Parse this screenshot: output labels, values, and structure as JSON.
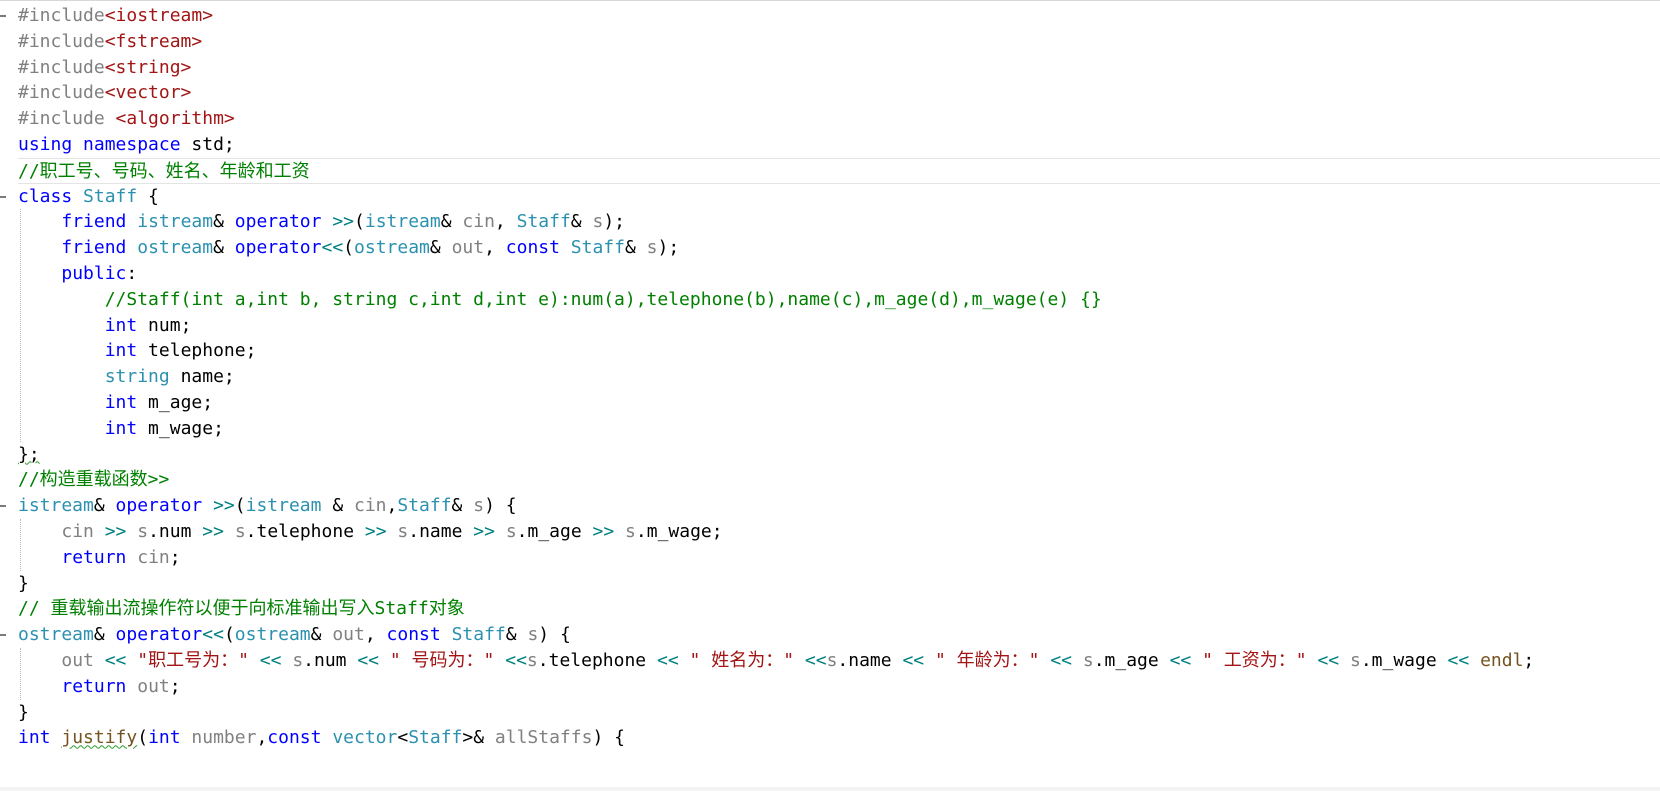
{
  "editor": {
    "fold_lines": [
      0,
      7,
      19,
      24
    ],
    "current_line": 6,
    "colors": {
      "preprocessor": "#808080",
      "include_path": "#a31515",
      "keyword": "#0000ff",
      "type": "#2b91af",
      "comment": "#008000",
      "operator": "#008080",
      "string": "#a31515",
      "parameter": "#808080",
      "function": "#74531f",
      "text": "#000000"
    },
    "lines": [
      [
        {
          "t": "#include",
          "c": "pre"
        },
        {
          "t": "<iostream>",
          "c": "inc"
        }
      ],
      [
        {
          "t": "#include",
          "c": "pre"
        },
        {
          "t": "<fstream>",
          "c": "inc"
        }
      ],
      [
        {
          "t": "#include",
          "c": "pre"
        },
        {
          "t": "<string>",
          "c": "inc"
        }
      ],
      [
        {
          "t": "#include",
          "c": "pre"
        },
        {
          "t": "<vector>",
          "c": "inc"
        }
      ],
      [
        {
          "t": "#include ",
          "c": "pre"
        },
        {
          "t": "<algorithm>",
          "c": "inc"
        }
      ],
      [
        {
          "t": "using",
          "c": "kw"
        },
        {
          "t": " ",
          "c": "txt"
        },
        {
          "t": "namespace",
          "c": "kw"
        },
        {
          "t": " std;",
          "c": "txt"
        }
      ],
      [
        {
          "t": "//职工号、号码、姓名、年龄和工资",
          "c": "com"
        }
      ],
      [
        {
          "t": "class",
          "c": "kw"
        },
        {
          "t": " ",
          "c": "txt"
        },
        {
          "t": "Staff",
          "c": "type"
        },
        {
          "t": " {",
          "c": "txt"
        }
      ],
      [
        {
          "t": "    ",
          "c": "txt"
        },
        {
          "t": "friend",
          "c": "kw"
        },
        {
          "t": " ",
          "c": "txt"
        },
        {
          "t": "istream",
          "c": "type"
        },
        {
          "t": "& ",
          "c": "txt"
        },
        {
          "t": "operator",
          "c": "kw"
        },
        {
          "t": " ",
          "c": "txt"
        },
        {
          "t": ">>",
          "c": "op"
        },
        {
          "t": "(",
          "c": "txt"
        },
        {
          "t": "istream",
          "c": "type"
        },
        {
          "t": "& ",
          "c": "txt"
        },
        {
          "t": "cin",
          "c": "par"
        },
        {
          "t": ", ",
          "c": "txt"
        },
        {
          "t": "Staff",
          "c": "type"
        },
        {
          "t": "& ",
          "c": "txt"
        },
        {
          "t": "s",
          "c": "par"
        },
        {
          "t": ");",
          "c": "txt"
        }
      ],
      [
        {
          "t": "    ",
          "c": "txt"
        },
        {
          "t": "friend",
          "c": "kw"
        },
        {
          "t": " ",
          "c": "txt"
        },
        {
          "t": "ostream",
          "c": "type"
        },
        {
          "t": "& ",
          "c": "txt"
        },
        {
          "t": "operator",
          "c": "kw"
        },
        {
          "t": "<<",
          "c": "op"
        },
        {
          "t": "(",
          "c": "txt"
        },
        {
          "t": "ostream",
          "c": "type"
        },
        {
          "t": "& ",
          "c": "txt"
        },
        {
          "t": "out",
          "c": "par"
        },
        {
          "t": ", ",
          "c": "txt"
        },
        {
          "t": "const",
          "c": "kw"
        },
        {
          "t": " ",
          "c": "txt"
        },
        {
          "t": "Staff",
          "c": "type"
        },
        {
          "t": "& ",
          "c": "txt"
        },
        {
          "t": "s",
          "c": "par"
        },
        {
          "t": ");",
          "c": "txt"
        }
      ],
      [
        {
          "t": "    ",
          "c": "txt"
        },
        {
          "t": "public",
          "c": "kw"
        },
        {
          "t": ":",
          "c": "txt"
        }
      ],
      [
        {
          "t": "        //Staff(int a,int b, string c,int d,int e):num(a),telephone(b),name(c),m_age(d),m_wage(e) {}",
          "c": "com"
        }
      ],
      [
        {
          "t": "        ",
          "c": "txt"
        },
        {
          "t": "int",
          "c": "kw"
        },
        {
          "t": " num;",
          "c": "txt"
        }
      ],
      [
        {
          "t": "        ",
          "c": "txt"
        },
        {
          "t": "int",
          "c": "kw"
        },
        {
          "t": " telephone;",
          "c": "txt"
        }
      ],
      [
        {
          "t": "        ",
          "c": "txt"
        },
        {
          "t": "string",
          "c": "type"
        },
        {
          "t": " name;",
          "c": "txt"
        }
      ],
      [
        {
          "t": "        ",
          "c": "txt"
        },
        {
          "t": "int",
          "c": "kw"
        },
        {
          "t": " m_age;",
          "c": "txt"
        }
      ],
      [
        {
          "t": "        ",
          "c": "txt"
        },
        {
          "t": "int",
          "c": "kw"
        },
        {
          "t": " m_wage;",
          "c": "txt"
        }
      ],
      [
        {
          "t": "};",
          "c": "txt"
        }
      ],
      [
        {
          "t": "//构造重载函数>>",
          "c": "com"
        }
      ],
      [
        {
          "t": "istream",
          "c": "type"
        },
        {
          "t": "& ",
          "c": "txt"
        },
        {
          "t": "operator",
          "c": "kw"
        },
        {
          "t": " ",
          "c": "txt"
        },
        {
          "t": ">>",
          "c": "op"
        },
        {
          "t": "(",
          "c": "txt"
        },
        {
          "t": "istream",
          "c": "type"
        },
        {
          "t": " & ",
          "c": "txt"
        },
        {
          "t": "cin",
          "c": "par"
        },
        {
          "t": ",",
          "c": "txt"
        },
        {
          "t": "Staff",
          "c": "type"
        },
        {
          "t": "& ",
          "c": "txt"
        },
        {
          "t": "s",
          "c": "par"
        },
        {
          "t": ") {",
          "c": "txt"
        }
      ],
      [
        {
          "t": "    ",
          "c": "txt"
        },
        {
          "t": "cin",
          "c": "par"
        },
        {
          "t": " ",
          "c": "txt"
        },
        {
          "t": ">>",
          "c": "op"
        },
        {
          "t": " ",
          "c": "txt"
        },
        {
          "t": "s",
          "c": "par"
        },
        {
          "t": ".num ",
          "c": "txt"
        },
        {
          "t": ">>",
          "c": "op"
        },
        {
          "t": " ",
          "c": "txt"
        },
        {
          "t": "s",
          "c": "par"
        },
        {
          "t": ".telephone ",
          "c": "txt"
        },
        {
          "t": ">>",
          "c": "op"
        },
        {
          "t": " ",
          "c": "txt"
        },
        {
          "t": "s",
          "c": "par"
        },
        {
          "t": ".name ",
          "c": "txt"
        },
        {
          "t": ">>",
          "c": "op"
        },
        {
          "t": " ",
          "c": "txt"
        },
        {
          "t": "s",
          "c": "par"
        },
        {
          "t": ".m_age ",
          "c": "txt"
        },
        {
          "t": ">>",
          "c": "op"
        },
        {
          "t": " ",
          "c": "txt"
        },
        {
          "t": "s",
          "c": "par"
        },
        {
          "t": ".m_wage;",
          "c": "txt"
        }
      ],
      [
        {
          "t": "    ",
          "c": "txt"
        },
        {
          "t": "return",
          "c": "kw"
        },
        {
          "t": " ",
          "c": "txt"
        },
        {
          "t": "cin",
          "c": "par"
        },
        {
          "t": ";",
          "c": "txt"
        }
      ],
      [
        {
          "t": "}",
          "c": "txt"
        }
      ],
      [
        {
          "t": "// 重载输出流操作符以便于向标准输出写入Staff对象",
          "c": "com"
        }
      ],
      [
        {
          "t": "ostream",
          "c": "type"
        },
        {
          "t": "& ",
          "c": "txt"
        },
        {
          "t": "operator",
          "c": "kw"
        },
        {
          "t": "<<",
          "c": "op"
        },
        {
          "t": "(",
          "c": "txt"
        },
        {
          "t": "ostream",
          "c": "type"
        },
        {
          "t": "& ",
          "c": "txt"
        },
        {
          "t": "out",
          "c": "par"
        },
        {
          "t": ", ",
          "c": "txt"
        },
        {
          "t": "const",
          "c": "kw"
        },
        {
          "t": " ",
          "c": "txt"
        },
        {
          "t": "Staff",
          "c": "type"
        },
        {
          "t": "& ",
          "c": "txt"
        },
        {
          "t": "s",
          "c": "par"
        },
        {
          "t": ") {",
          "c": "txt"
        }
      ],
      [
        {
          "t": "    ",
          "c": "txt"
        },
        {
          "t": "out",
          "c": "par"
        },
        {
          "t": " ",
          "c": "txt"
        },
        {
          "t": "<<",
          "c": "op"
        },
        {
          "t": " ",
          "c": "txt"
        },
        {
          "t": "\"职工号为：\"",
          "c": "str"
        },
        {
          "t": " ",
          "c": "txt"
        },
        {
          "t": "<<",
          "c": "op"
        },
        {
          "t": " ",
          "c": "txt"
        },
        {
          "t": "s",
          "c": "par"
        },
        {
          "t": ".num ",
          "c": "txt"
        },
        {
          "t": "<<",
          "c": "op"
        },
        {
          "t": " ",
          "c": "txt"
        },
        {
          "t": "\" 号码为：\"",
          "c": "str"
        },
        {
          "t": " ",
          "c": "txt"
        },
        {
          "t": "<<",
          "c": "op"
        },
        {
          "t": "s",
          "c": "par"
        },
        {
          "t": ".telephone ",
          "c": "txt"
        },
        {
          "t": "<<",
          "c": "op"
        },
        {
          "t": " ",
          "c": "txt"
        },
        {
          "t": "\" 姓名为：\"",
          "c": "str"
        },
        {
          "t": " ",
          "c": "txt"
        },
        {
          "t": "<<",
          "c": "op"
        },
        {
          "t": "s",
          "c": "par"
        },
        {
          "t": ".name ",
          "c": "txt"
        },
        {
          "t": "<<",
          "c": "op"
        },
        {
          "t": " ",
          "c": "txt"
        },
        {
          "t": "\" 年龄为：\"",
          "c": "str"
        },
        {
          "t": " ",
          "c": "txt"
        },
        {
          "t": "<<",
          "c": "op"
        },
        {
          "t": " ",
          "c": "txt"
        },
        {
          "t": "s",
          "c": "par"
        },
        {
          "t": ".m_age ",
          "c": "txt"
        },
        {
          "t": "<<",
          "c": "op"
        },
        {
          "t": " ",
          "c": "txt"
        },
        {
          "t": "\" 工资为：\"",
          "c": "str"
        },
        {
          "t": " ",
          "c": "txt"
        },
        {
          "t": "<<",
          "c": "op"
        },
        {
          "t": " ",
          "c": "txt"
        },
        {
          "t": "s",
          "c": "par"
        },
        {
          "t": ".m_wage ",
          "c": "txt"
        },
        {
          "t": "<<",
          "c": "op"
        },
        {
          "t": " ",
          "c": "txt"
        },
        {
          "t": "endl",
          "c": "fn"
        },
        {
          "t": ";",
          "c": "txt"
        }
      ],
      [
        {
          "t": "    ",
          "c": "txt"
        },
        {
          "t": "return",
          "c": "kw"
        },
        {
          "t": " ",
          "c": "txt"
        },
        {
          "t": "out",
          "c": "par"
        },
        {
          "t": ";",
          "c": "txt"
        }
      ],
      [
        {
          "t": "}",
          "c": "txt"
        }
      ],
      [
        {
          "t": "int",
          "c": "kw"
        },
        {
          "t": " ",
          "c": "txt"
        },
        {
          "t": "justify",
          "c": "fn"
        },
        {
          "t": "(",
          "c": "txt"
        },
        {
          "t": "int",
          "c": "kw"
        },
        {
          "t": " ",
          "c": "txt"
        },
        {
          "t": "number",
          "c": "par"
        },
        {
          "t": ",",
          "c": "txt"
        },
        {
          "t": "const",
          "c": "kw"
        },
        {
          "t": " ",
          "c": "txt"
        },
        {
          "t": "vector",
          "c": "type"
        },
        {
          "t": "<",
          "c": "txt"
        },
        {
          "t": "Staff",
          "c": "type"
        },
        {
          "t": ">& ",
          "c": "txt"
        },
        {
          "t": "allStaffs",
          "c": "par"
        },
        {
          "t": ") {",
          "c": "txt"
        }
      ]
    ]
  }
}
